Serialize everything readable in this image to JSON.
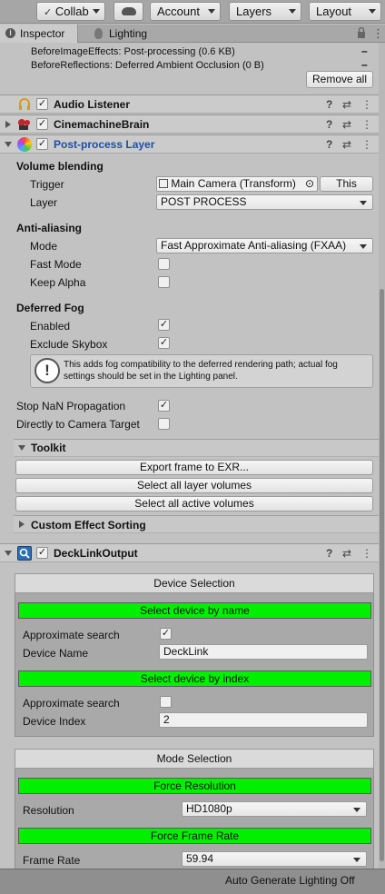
{
  "toolbar": {
    "collab": "Collab",
    "account": "Account",
    "layers": "Layers",
    "layout": "Layout"
  },
  "tabs": {
    "inspector": "Inspector",
    "lighting": "Lighting"
  },
  "effects_list": {
    "row1": "BeforeImageEffects: Post-processing (0.6 KB)",
    "row2": "BeforeReflections: Deferred Ambient Occlusion (0 B)",
    "remove_all": "Remove all"
  },
  "components": {
    "audio_listener": "Audio Listener",
    "cinemachine_brain": "CinemachineBrain",
    "post_process_layer": "Post-process Layer",
    "decklink_output": "DeckLinkOutput"
  },
  "post_process": {
    "volume_blending": "Volume blending",
    "trigger_label": "Trigger",
    "trigger_value": "Main Camera (Transform)",
    "this_button": "This",
    "layer_label": "Layer",
    "layer_value": "POST PROCESS",
    "anti_aliasing": "Anti-aliasing",
    "mode_label": "Mode",
    "mode_value": "Fast Approximate Anti-aliasing (FXAA)",
    "fast_mode": "Fast Mode",
    "keep_alpha": "Keep Alpha",
    "deferred_fog": "Deferred Fog",
    "enabled": "Enabled",
    "exclude_skybox": "Exclude Skybox",
    "fog_info": "This adds fog compatibility to the deferred rendering path; actual fog settings should be set in the Lighting panel.",
    "stop_nan": "Stop NaN Propagation",
    "direct_to_target": "Directly to Camera Target",
    "toolkit": "Toolkit",
    "export_frame": "Export frame to EXR...",
    "select_layer_volumes": "Select all layer volumes",
    "select_active_volumes": "Select all active volumes",
    "custom_effect_sorting": "Custom Effect Sorting"
  },
  "decklink": {
    "device_selection": "Device Selection",
    "select_by_name": "Select device by name",
    "approx_search_1": "Approximate search",
    "device_name_label": "Device Name",
    "device_name_value": "DeckLink",
    "select_by_index": "Select device by index",
    "approx_search_2": "Approximate search",
    "device_index_label": "Device Index",
    "device_index_value": "2",
    "mode_selection": "Mode Selection",
    "force_resolution": "Force Resolution",
    "resolution_label": "Resolution",
    "resolution_value": "HD1080p",
    "force_frame_rate": "Force Frame Rate",
    "frame_rate_label": "Frame Rate",
    "frame_rate_value": "59.94"
  },
  "status": {
    "auto_lighting": "Auto Generate Lighting Off"
  },
  "checkbox_mark": "✓",
  "icons": {
    "help": "?",
    "presets": "⇄",
    "menu": "⋮",
    "remove": "–",
    "lock": "🔒",
    "more": "⋮",
    "target": "⊙",
    "warning": "!"
  }
}
